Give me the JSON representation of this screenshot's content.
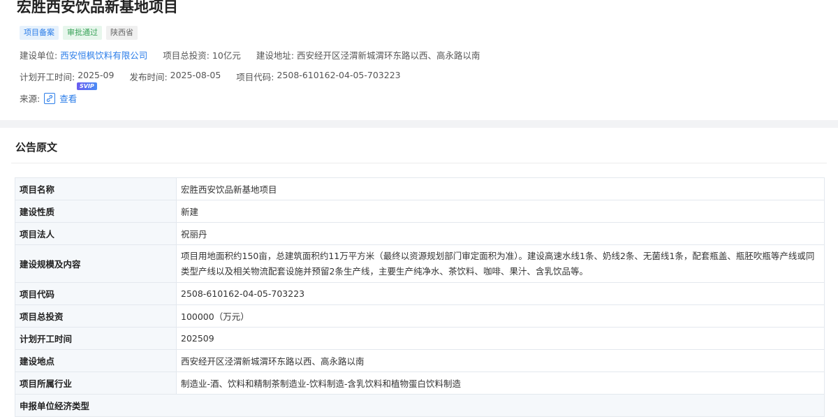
{
  "project": {
    "title": "宏胜西安饮品新基地项目",
    "tags": [
      "项目备案",
      "审批通过",
      "陕西省"
    ],
    "builder_label": "建设单位:",
    "builder_value": "西安恒枫饮料有限公司",
    "investment_label": "项目总投资:",
    "investment_value": "10亿元",
    "address_label": "建设地址:",
    "address_value": "西安经开区泾渭新城渭环东路以西、高永路以南",
    "start_label": "计划开工时间:",
    "start_value": "2025-09",
    "publish_label": "发布时间:",
    "publish_value": "2025-08-05",
    "code_label": "项目代码:",
    "code_value": "2508-610162-04-05-703223",
    "source_label": "来源:",
    "source_link": "查看",
    "svip_badge": "SVIP"
  },
  "notice": {
    "title": "公告原文",
    "rows": [
      {
        "key": "项目名称",
        "value": "宏胜西安饮品新基地项目"
      },
      {
        "key": "建设性质",
        "value": "新建"
      },
      {
        "key": "项目法人",
        "value": "祝丽丹"
      },
      {
        "key": "建设规模及内容",
        "value": "项目用地面积约150亩，总建筑面积约11万平方米（最终以资源规划部门审定面积为准）。建设高速水线1条、奶线2条、无菌线1条，配套瓶盖、瓶胚吹瓶等产线或同类型产线以及相关物流配套设施并预留2条生产线，主要生产纯净水、茶饮料、咖啡、果汁、含乳饮品等。"
      },
      {
        "key": "项目代码",
        "value": "2508-610162-04-05-703223"
      },
      {
        "key": "项目总投资",
        "value": "100000（万元）"
      },
      {
        "key": "计划开工时间",
        "value": "202509"
      },
      {
        "key": "建设地点",
        "value": "西安经开区泾渭新城渭环东路以西、高永路以南"
      },
      {
        "key": "项目所属行业",
        "value": "制造业-酒、饮料和精制茶制造业-饮料制造-含乳饮料和植物蛋白饮料制造"
      },
      {
        "key": "申报单位经济类型",
        "value": ""
      }
    ]
  },
  "colors": {
    "accent": "#2b7de9",
    "success": "#3aa35a"
  },
  "icons": {
    "source": "link-icon"
  }
}
